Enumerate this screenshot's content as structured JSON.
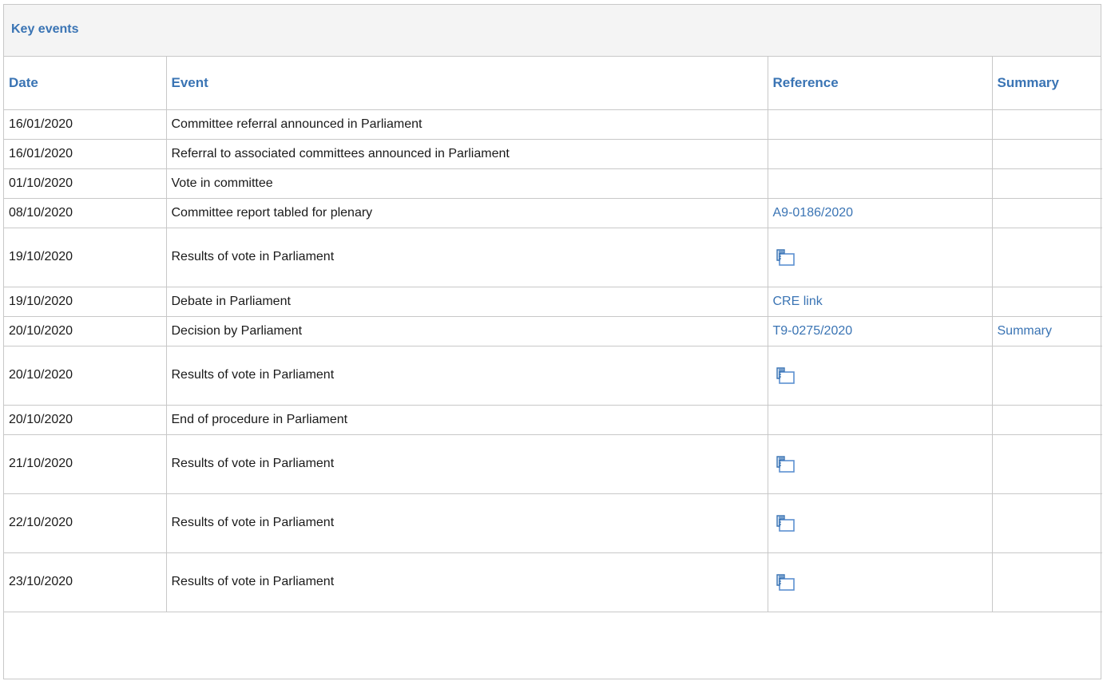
{
  "panel": {
    "title": "Key events"
  },
  "table": {
    "headers": {
      "date": "Date",
      "event": "Event",
      "reference": "Reference",
      "summary": "Summary"
    },
    "rows": [
      {
        "date": "16/01/2020",
        "event": "Committee referral announced in Parliament",
        "reference": "",
        "reference_type": "none",
        "summary": ""
      },
      {
        "date": "16/01/2020",
        "event": "Referral to associated committees announced in Parliament",
        "reference": "",
        "reference_type": "none",
        "summary": ""
      },
      {
        "date": "01/10/2020",
        "event": "Vote in committee",
        "reference": "",
        "reference_type": "none",
        "summary": ""
      },
      {
        "date": "08/10/2020",
        "event": "Committee report tabled for plenary",
        "reference": "A9-0186/2020",
        "reference_type": "link",
        "summary": ""
      },
      {
        "date": "19/10/2020",
        "event": "Results of vote in Parliament",
        "reference": "",
        "reference_type": "vote-icon",
        "summary": ""
      },
      {
        "date": "19/10/2020",
        "event": "Debate in Parliament",
        "reference": "CRE link",
        "reference_type": "link",
        "summary": ""
      },
      {
        "date": "20/10/2020",
        "event": "Decision by Parliament",
        "reference": "T9-0275/2020",
        "reference_type": "link",
        "summary": "Summary"
      },
      {
        "date": "20/10/2020",
        "event": "Results of vote in Parliament",
        "reference": "",
        "reference_type": "vote-icon",
        "summary": ""
      },
      {
        "date": "20/10/2020",
        "event": "End of procedure in Parliament",
        "reference": "",
        "reference_type": "none",
        "summary": ""
      },
      {
        "date": "21/10/2020",
        "event": "Results of vote in Parliament",
        "reference": "",
        "reference_type": "vote-icon",
        "summary": ""
      },
      {
        "date": "22/10/2020",
        "event": "Results of vote in Parliament",
        "reference": "",
        "reference_type": "vote-icon",
        "summary": ""
      },
      {
        "date": "23/10/2020",
        "event": "Results of vote in Parliament",
        "reference": "",
        "reference_type": "vote-icon",
        "summary": ""
      }
    ]
  },
  "colors": {
    "accent": "#3a74b4",
    "border": "#c8c8c8",
    "header_bg": "#f4f4f4",
    "text": "#1a1a1a"
  },
  "icons": {
    "vote_results": "ballot-box-icon"
  }
}
